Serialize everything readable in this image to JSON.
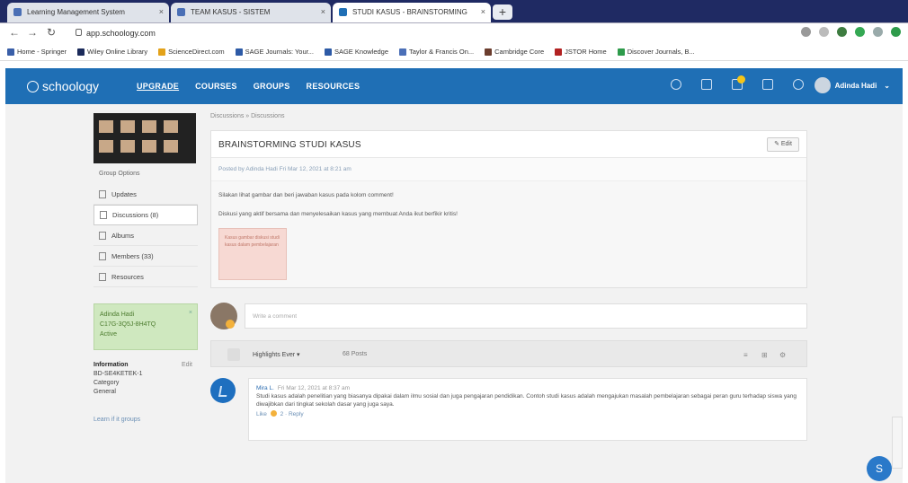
{
  "browser": {
    "tabs": [
      {
        "label": "Learning Management System",
        "active": false
      },
      {
        "label": "TEAM KASUS - SISTEM",
        "active": false
      },
      {
        "label": "STUDI KASUS - BRAINSTORMING",
        "active": true
      }
    ],
    "url": "app.schoology.com",
    "bookmarks": [
      "Home - Springer",
      "Wiley Online Library",
      "ScienceDirect.com",
      "SAGE Journals: Your...",
      "SAGE Knowledge",
      "Taylor & Francis On...",
      "Cambridge Core",
      "JSTOR Home",
      "Discover Journals, B..."
    ]
  },
  "nav": {
    "logo": "schoology",
    "links": [
      "UPGRADE",
      "COURSES",
      "GROUPS",
      "RESOURCES"
    ],
    "user_name": "Adinda Hadi"
  },
  "sidebar": {
    "group_options": "Group Options",
    "items": [
      "Updates",
      "Discussions (8)",
      "Albums",
      "Members (33)",
      "Resources"
    ],
    "info_box": {
      "name": "Adinda Hadi",
      "code": "C17G-3Q5J-8H4TQ",
      "status": "Active"
    },
    "information_label": "Information",
    "edit_label": "Edit",
    "info_lines": [
      "BD-SE4KETEK-1",
      "Category",
      "General"
    ],
    "learn_link": "Learn if it groups"
  },
  "main": {
    "breadcrumb": "Discussions » Discussions",
    "title": "BRAINSTORMING STUDI KASUS",
    "edit_button": "Edit",
    "meta": "Posted by Adinda Hadi Fri Mar 12, 2021 at 8:21 am",
    "body": [
      "Silakan lihat gambar dan beri jawaban kasus pada kolom comment!",
      "Diskusi yang aktif bersama dan menyelesaikan kasus yang membuat Anda ikut berfikir kritis!"
    ],
    "attachment_text": "Kasus gambar diskusi studi kasus dalam pembelajaran",
    "comment_placeholder": "Write a comment",
    "filter": {
      "label": "Highlights Ever",
      "count": "68 Posts"
    },
    "post": {
      "author": "Mira L.",
      "date": "Fri Mar 12, 2021 at 8:37 am",
      "text": "Studi kasus adalah penelitian yang biasanya dipakai dalam ilmu sosial dan juga pengajaran pendidikan. Contoh studi kasus adalah mengajukan masalah pembelajaran sebagai peran guru terhadap siswa yang diwajibkan dari tingkat sekolah dasar yang juga saya.",
      "actions": "Like",
      "likes": "2",
      "reply": "Reply"
    }
  },
  "fab_label": "S"
}
